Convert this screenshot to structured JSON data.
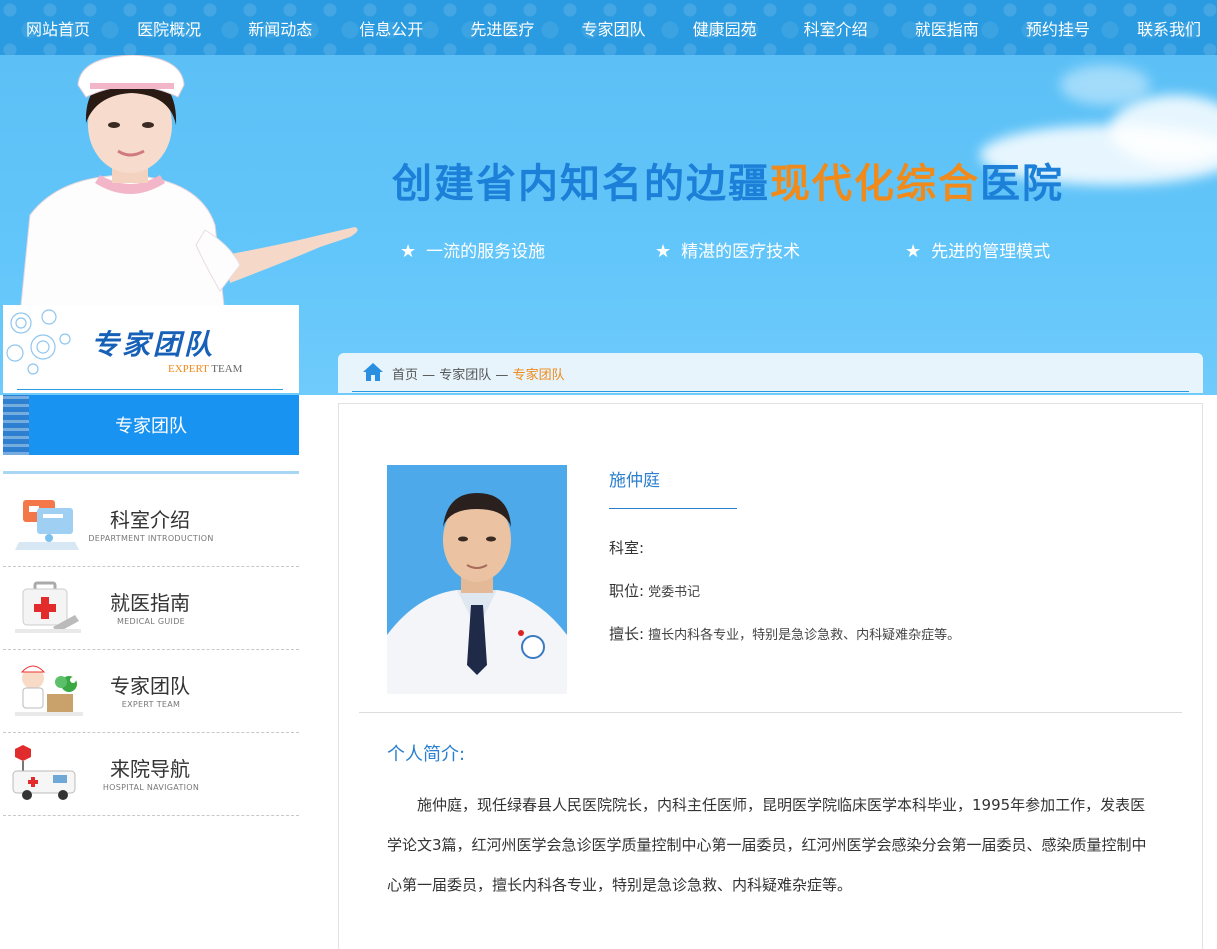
{
  "nav": [
    "网站首页",
    "医院概况",
    "新闻动态",
    "信息公开",
    "先进医疗",
    "专家团队",
    "健康园苑",
    "科室介绍",
    "就医指南",
    "预约挂号",
    "联系我们"
  ],
  "banner": {
    "title_part1": "创建省内知名的边疆",
    "title_part2": "现代化综合",
    "title_part3": "医院",
    "features": [
      "一流的服务设施",
      "精湛的医疗技术",
      "先进的管理模式"
    ],
    "star": "★"
  },
  "sidebar": {
    "heading_cn": "专家团队",
    "heading_en_accent": "EXPERT",
    "heading_en_rest": " TEAM",
    "active": "专家团队",
    "items": [
      {
        "title": "科室介绍",
        "subtitle": "DEPARTMENT INTRODUCTION",
        "icon": "department-icon"
      },
      {
        "title": "就医指南",
        "subtitle": "MEDICAL GUIDE",
        "icon": "first-aid-kit-icon"
      },
      {
        "title": "专家团队",
        "subtitle": "EXPERT TEAM",
        "icon": "doctor-icon"
      },
      {
        "title": "来院导航",
        "subtitle": "HOSPITAL NAVIGATION",
        "icon": "ambulance-icon"
      }
    ]
  },
  "breadcrumb": {
    "home": "首页",
    "sep": " — ",
    "section": "专家团队",
    "current": "专家团队"
  },
  "doctor": {
    "name": "施仲庭",
    "department_label": "科室:",
    "department_value": "",
    "position_label": "职位:",
    "position_value": "党委书记",
    "specialty_label": "擅长:",
    "specialty_value": "擅长内科各专业，特别是急诊急救、内科疑难杂症等。"
  },
  "bio": {
    "title": "个人简介:",
    "text": "施仲庭，现任绿春县人民医院院长，内科主任医师，昆明医学院临床医学本科毕业，1995年参加工作，发表医学论文3篇，红河州医学会急诊医学质量控制中心第一届委员，红河州医学会感染分会第一届委员、感染质量控制中心第一届委员，擅长内科各专业，特别是急诊急救、内科疑难杂症等。"
  },
  "colors": {
    "nav": "#2a9be0",
    "accent": "#f08a1a",
    "title_blue": "#1c7fd8",
    "active_tab": "#1993f2"
  }
}
